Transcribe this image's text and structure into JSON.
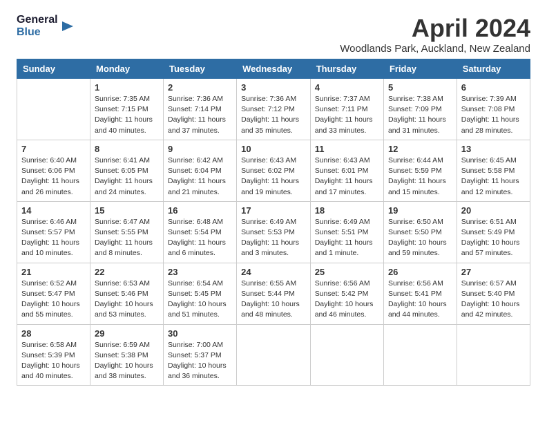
{
  "header": {
    "logo_line1": "General",
    "logo_line2": "Blue",
    "month": "April 2024",
    "location": "Woodlands Park, Auckland, New Zealand"
  },
  "columns": [
    "Sunday",
    "Monday",
    "Tuesday",
    "Wednesday",
    "Thursday",
    "Friday",
    "Saturday"
  ],
  "weeks": [
    [
      {
        "day": "",
        "info": ""
      },
      {
        "day": "1",
        "info": "Sunrise: 7:35 AM\nSunset: 7:15 PM\nDaylight: 11 hours\nand 40 minutes."
      },
      {
        "day": "2",
        "info": "Sunrise: 7:36 AM\nSunset: 7:14 PM\nDaylight: 11 hours\nand 37 minutes."
      },
      {
        "day": "3",
        "info": "Sunrise: 7:36 AM\nSunset: 7:12 PM\nDaylight: 11 hours\nand 35 minutes."
      },
      {
        "day": "4",
        "info": "Sunrise: 7:37 AM\nSunset: 7:11 PM\nDaylight: 11 hours\nand 33 minutes."
      },
      {
        "day": "5",
        "info": "Sunrise: 7:38 AM\nSunset: 7:09 PM\nDaylight: 11 hours\nand 31 minutes."
      },
      {
        "day": "6",
        "info": "Sunrise: 7:39 AM\nSunset: 7:08 PM\nDaylight: 11 hours\nand 28 minutes."
      }
    ],
    [
      {
        "day": "7",
        "info": "Sunrise: 6:40 AM\nSunset: 6:06 PM\nDaylight: 11 hours\nand 26 minutes."
      },
      {
        "day": "8",
        "info": "Sunrise: 6:41 AM\nSunset: 6:05 PM\nDaylight: 11 hours\nand 24 minutes."
      },
      {
        "day": "9",
        "info": "Sunrise: 6:42 AM\nSunset: 6:04 PM\nDaylight: 11 hours\nand 21 minutes."
      },
      {
        "day": "10",
        "info": "Sunrise: 6:43 AM\nSunset: 6:02 PM\nDaylight: 11 hours\nand 19 minutes."
      },
      {
        "day": "11",
        "info": "Sunrise: 6:43 AM\nSunset: 6:01 PM\nDaylight: 11 hours\nand 17 minutes."
      },
      {
        "day": "12",
        "info": "Sunrise: 6:44 AM\nSunset: 5:59 PM\nDaylight: 11 hours\nand 15 minutes."
      },
      {
        "day": "13",
        "info": "Sunrise: 6:45 AM\nSunset: 5:58 PM\nDaylight: 11 hours\nand 12 minutes."
      }
    ],
    [
      {
        "day": "14",
        "info": "Sunrise: 6:46 AM\nSunset: 5:57 PM\nDaylight: 11 hours\nand 10 minutes."
      },
      {
        "day": "15",
        "info": "Sunrise: 6:47 AM\nSunset: 5:55 PM\nDaylight: 11 hours\nand 8 minutes."
      },
      {
        "day": "16",
        "info": "Sunrise: 6:48 AM\nSunset: 5:54 PM\nDaylight: 11 hours\nand 6 minutes."
      },
      {
        "day": "17",
        "info": "Sunrise: 6:49 AM\nSunset: 5:53 PM\nDaylight: 11 hours\nand 3 minutes."
      },
      {
        "day": "18",
        "info": "Sunrise: 6:49 AM\nSunset: 5:51 PM\nDaylight: 11 hours\nand 1 minute."
      },
      {
        "day": "19",
        "info": "Sunrise: 6:50 AM\nSunset: 5:50 PM\nDaylight: 10 hours\nand 59 minutes."
      },
      {
        "day": "20",
        "info": "Sunrise: 6:51 AM\nSunset: 5:49 PM\nDaylight: 10 hours\nand 57 minutes."
      }
    ],
    [
      {
        "day": "21",
        "info": "Sunrise: 6:52 AM\nSunset: 5:47 PM\nDaylight: 10 hours\nand 55 minutes."
      },
      {
        "day": "22",
        "info": "Sunrise: 6:53 AM\nSunset: 5:46 PM\nDaylight: 10 hours\nand 53 minutes."
      },
      {
        "day": "23",
        "info": "Sunrise: 6:54 AM\nSunset: 5:45 PM\nDaylight: 10 hours\nand 51 minutes."
      },
      {
        "day": "24",
        "info": "Sunrise: 6:55 AM\nSunset: 5:44 PM\nDaylight: 10 hours\nand 48 minutes."
      },
      {
        "day": "25",
        "info": "Sunrise: 6:56 AM\nSunset: 5:42 PM\nDaylight: 10 hours\nand 46 minutes."
      },
      {
        "day": "26",
        "info": "Sunrise: 6:56 AM\nSunset: 5:41 PM\nDaylight: 10 hours\nand 44 minutes."
      },
      {
        "day": "27",
        "info": "Sunrise: 6:57 AM\nSunset: 5:40 PM\nDaylight: 10 hours\nand 42 minutes."
      }
    ],
    [
      {
        "day": "28",
        "info": "Sunrise: 6:58 AM\nSunset: 5:39 PM\nDaylight: 10 hours\nand 40 minutes."
      },
      {
        "day": "29",
        "info": "Sunrise: 6:59 AM\nSunset: 5:38 PM\nDaylight: 10 hours\nand 38 minutes."
      },
      {
        "day": "30",
        "info": "Sunrise: 7:00 AM\nSunset: 5:37 PM\nDaylight: 10 hours\nand 36 minutes."
      },
      {
        "day": "",
        "info": ""
      },
      {
        "day": "",
        "info": ""
      },
      {
        "day": "",
        "info": ""
      },
      {
        "day": "",
        "info": ""
      }
    ]
  ]
}
